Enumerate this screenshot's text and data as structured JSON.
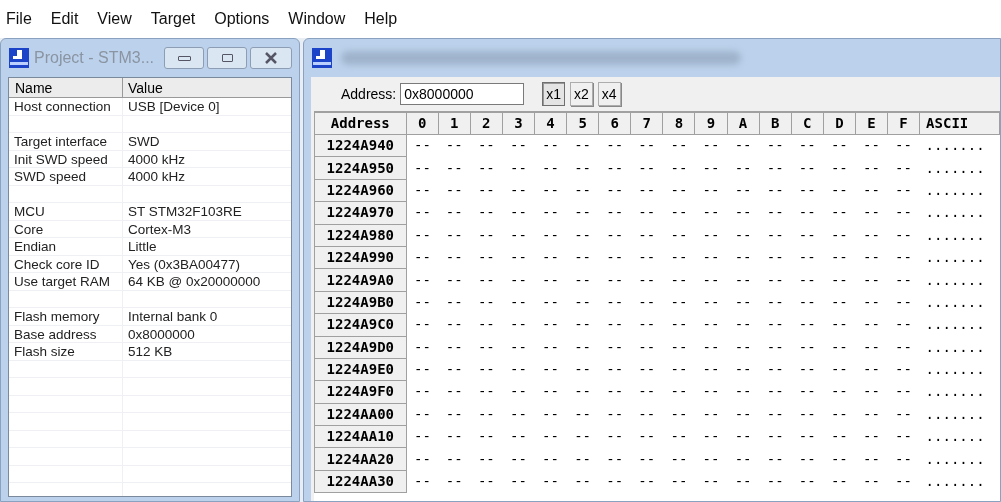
{
  "menu": [
    "File",
    "Edit",
    "View",
    "Target",
    "Options",
    "Window",
    "Help"
  ],
  "project_window": {
    "title": "Project - STM3...",
    "columns": [
      "Name",
      "Value"
    ],
    "groups": [
      [
        {
          "name": "Host connection",
          "value": "USB [Device 0]"
        }
      ],
      [
        {
          "name": "Target interface",
          "value": "SWD"
        },
        {
          "name": "Init SWD speed",
          "value": "4000 kHz"
        },
        {
          "name": "SWD speed",
          "value": "4000 kHz"
        }
      ],
      [
        {
          "name": "MCU",
          "value": "ST STM32F103RE"
        },
        {
          "name": "Core",
          "value": "Cortex-M3"
        },
        {
          "name": "Endian",
          "value": "Little"
        },
        {
          "name": "Check core ID",
          "value": "Yes (0x3BA00477)"
        },
        {
          "name": "Use target RAM",
          "value": "64 KB @ 0x20000000"
        }
      ],
      [
        {
          "name": "Flash memory",
          "value": "Internal bank 0"
        },
        {
          "name": "Base address",
          "value": "0x8000000"
        },
        {
          "name": "Flash size",
          "value": "512 KB"
        }
      ]
    ]
  },
  "memory_window": {
    "address_label": "Address:",
    "address_value": "0x8000000",
    "zoom_buttons": [
      {
        "label": "x1",
        "selected": true
      },
      {
        "label": "x2",
        "selected": false
      },
      {
        "label": "x4",
        "selected": false
      }
    ],
    "columns": [
      "Address",
      "0",
      "1",
      "2",
      "3",
      "4",
      "5",
      "6",
      "7",
      "8",
      "9",
      "A",
      "B",
      "C",
      "D",
      "E",
      "F",
      "ASCII"
    ],
    "rows": [
      [
        "1224A940",
        "--",
        "--",
        "--",
        "--",
        "--",
        "--",
        "--",
        "--",
        "--",
        "--",
        "--",
        "--",
        "--",
        "--",
        "--",
        "--",
        "......."
      ],
      [
        "1224A950",
        "--",
        "--",
        "--",
        "--",
        "--",
        "--",
        "--",
        "--",
        "--",
        "--",
        "--",
        "--",
        "--",
        "--",
        "--",
        "--",
        "......."
      ],
      [
        "1224A960",
        "--",
        "--",
        "--",
        "--",
        "--",
        "--",
        "--",
        "--",
        "--",
        "--",
        "--",
        "--",
        "--",
        "--",
        "--",
        "--",
        "......."
      ],
      [
        "1224A970",
        "--",
        "--",
        "--",
        "--",
        "--",
        "--",
        "--",
        "--",
        "--",
        "--",
        "--",
        "--",
        "--",
        "--",
        "--",
        "--",
        "......."
      ],
      [
        "1224A980",
        "--",
        "--",
        "--",
        "--",
        "--",
        "--",
        "--",
        "--",
        "--",
        "--",
        "--",
        "--",
        "--",
        "--",
        "--",
        "--",
        "......."
      ],
      [
        "1224A990",
        "--",
        "--",
        "--",
        "--",
        "--",
        "--",
        "--",
        "--",
        "--",
        "--",
        "--",
        "--",
        "--",
        "--",
        "--",
        "--",
        "......."
      ],
      [
        "1224A9A0",
        "--",
        "--",
        "--",
        "--",
        "--",
        "--",
        "--",
        "--",
        "--",
        "--",
        "--",
        "--",
        "--",
        "--",
        "--",
        "--",
        "......."
      ],
      [
        "1224A9B0",
        "--",
        "--",
        "--",
        "--",
        "--",
        "--",
        "--",
        "--",
        "--",
        "--",
        "--",
        "--",
        "--",
        "--",
        "--",
        "--",
        "......."
      ],
      [
        "1224A9C0",
        "--",
        "--",
        "--",
        "--",
        "--",
        "--",
        "--",
        "--",
        "--",
        "--",
        "--",
        "--",
        "--",
        "--",
        "--",
        "--",
        "......."
      ],
      [
        "1224A9D0",
        "--",
        "--",
        "--",
        "--",
        "--",
        "--",
        "--",
        "--",
        "--",
        "--",
        "--",
        "--",
        "--",
        "--",
        "--",
        "--",
        "......."
      ],
      [
        "1224A9E0",
        "--",
        "--",
        "--",
        "--",
        "--",
        "--",
        "--",
        "--",
        "--",
        "--",
        "--",
        "--",
        "--",
        "--",
        "--",
        "--",
        "......."
      ],
      [
        "1224A9F0",
        "--",
        "--",
        "--",
        "--",
        "--",
        "--",
        "--",
        "--",
        "--",
        "--",
        "--",
        "--",
        "--",
        "--",
        "--",
        "--",
        "......."
      ],
      [
        "1224AA00",
        "--",
        "--",
        "--",
        "--",
        "--",
        "--",
        "--",
        "--",
        "--",
        "--",
        "--",
        "--",
        "--",
        "--",
        "--",
        "--",
        "......."
      ],
      [
        "1224AA10",
        "--",
        "--",
        "--",
        "--",
        "--",
        "--",
        "--",
        "--",
        "--",
        "--",
        "--",
        "--",
        "--",
        "--",
        "--",
        "--",
        "......."
      ],
      [
        "1224AA20",
        "--",
        "--",
        "--",
        "--",
        "--",
        "--",
        "--",
        "--",
        "--",
        "--",
        "--",
        "--",
        "--",
        "--",
        "--",
        "--",
        "......."
      ],
      [
        "1224AA30",
        "--",
        "--",
        "--",
        "--",
        "--",
        "--",
        "--",
        "--",
        "--",
        "--",
        "--",
        "--",
        "--",
        "--",
        "--",
        "--",
        "......."
      ]
    ]
  }
}
